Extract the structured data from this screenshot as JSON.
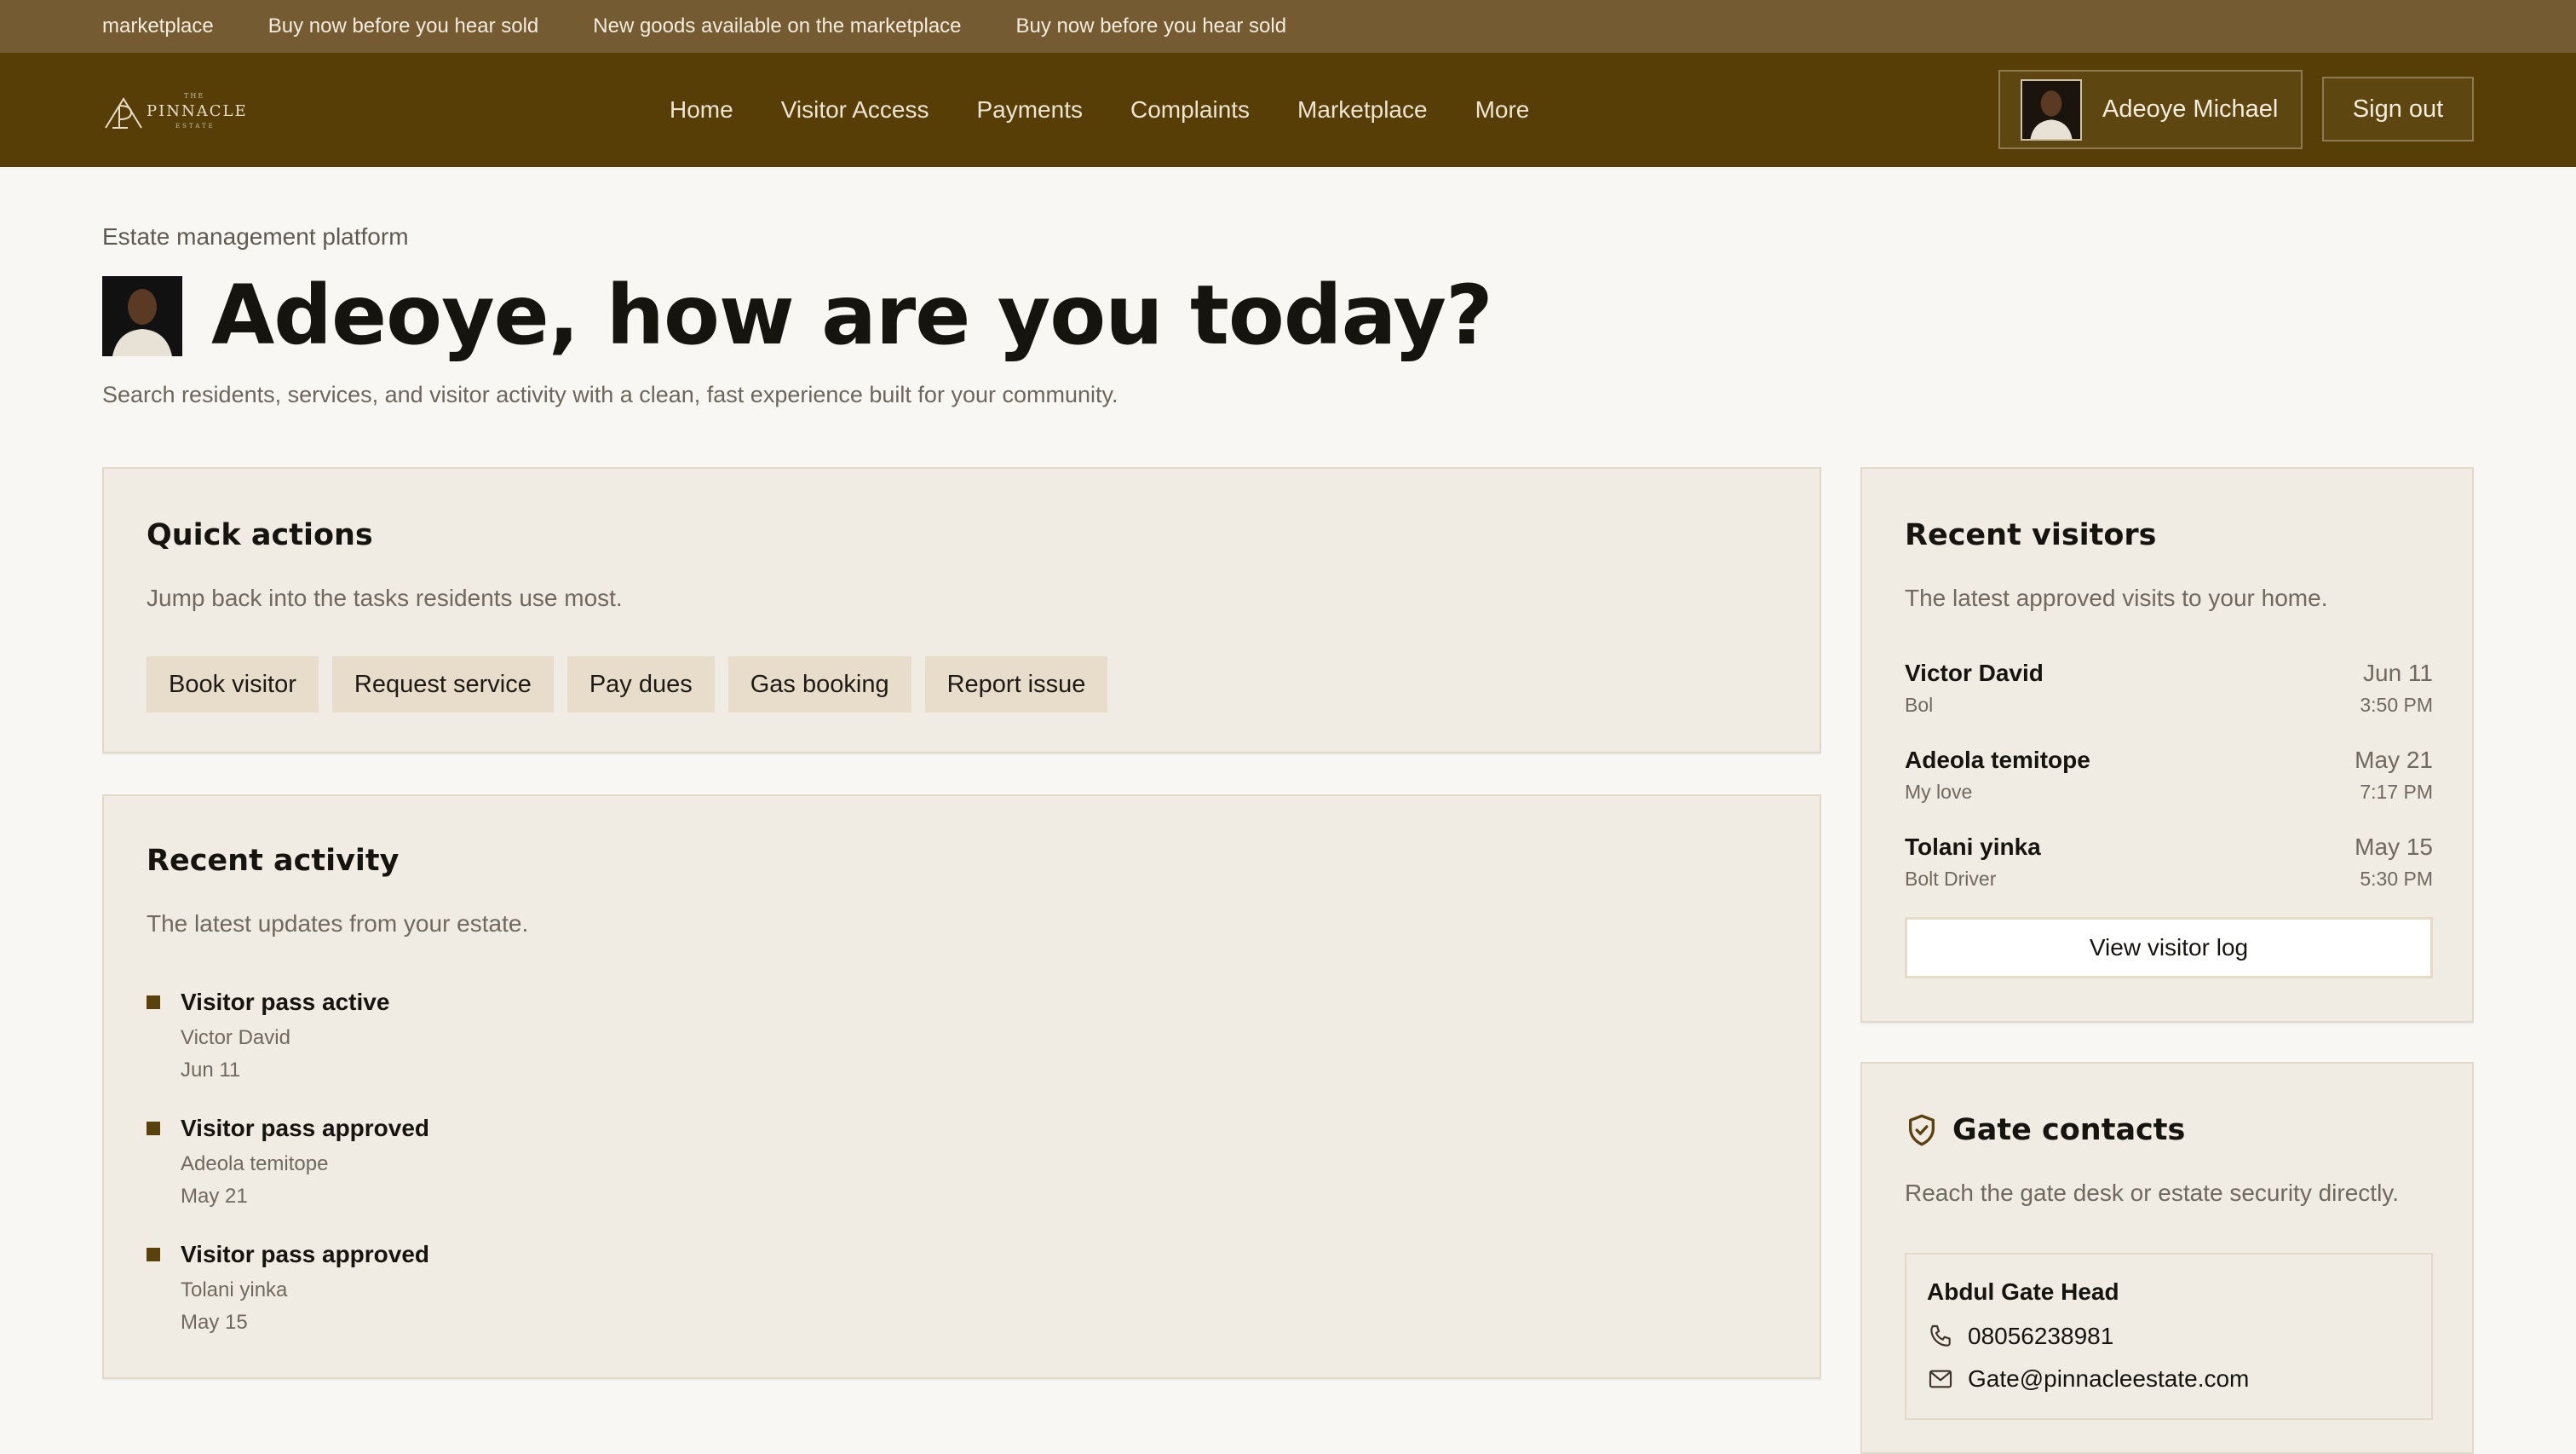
{
  "ticker": [
    "marketplace",
    "Buy now before you hear sold",
    "New goods available on the marketplace",
    "Buy now before you hear sold"
  ],
  "brand": {
    "top": "THE",
    "name": "PINNACLE",
    "sub": "ESTATE"
  },
  "nav": [
    "Home",
    "Visitor Access",
    "Payments",
    "Complaints",
    "Marketplace",
    "More"
  ],
  "user": {
    "name": "Adeoye Michael",
    "signout": "Sign out"
  },
  "hero": {
    "eyebrow": "Estate management platform",
    "title": "Adeoye, how are you today?",
    "subtitle": "Search residents, services, and visitor activity with a clean, fast experience built for your community."
  },
  "quick_actions": {
    "title": "Quick actions",
    "desc": "Jump back into the tasks residents use most.",
    "actions": [
      "Book visitor",
      "Request service",
      "Pay dues",
      "Gas booking",
      "Report issue"
    ]
  },
  "recent_activity": {
    "title": "Recent activity",
    "desc": "The latest updates from your estate.",
    "items": [
      {
        "title": "Visitor pass active",
        "person": "Victor David",
        "date": "Jun 11"
      },
      {
        "title": "Visitor pass approved",
        "person": "Adeola temitope",
        "date": "May 21"
      },
      {
        "title": "Visitor pass approved",
        "person": "Tolani yinka",
        "date": "May 15"
      }
    ]
  },
  "recent_visitors": {
    "title": "Recent visitors",
    "desc": "The latest approved visits to your home.",
    "items": [
      {
        "name": "Victor David",
        "relation": "Bol",
        "date": "Jun 11",
        "time": "3:50 PM"
      },
      {
        "name": "Adeola temitope",
        "relation": "My love",
        "date": "May 21",
        "time": "7:17 PM"
      },
      {
        "name": "Tolani yinka",
        "relation": "Bolt Driver",
        "date": "May 15",
        "time": "5:30 PM"
      }
    ],
    "button": "View visitor log"
  },
  "gate_contacts": {
    "title": "Gate contacts",
    "desc": "Reach the gate desk or estate security directly.",
    "contact": {
      "name": "Abdul Gate Head",
      "phone": "08056238981",
      "email": "Gate@pinnacleestate.com"
    }
  },
  "colors": {
    "nav_bg": "#563e06",
    "ticker_bg": "#745b32",
    "accent": "#5a420d",
    "card_bg": "#f1ece3",
    "page_bg": "#f8f7f3"
  }
}
